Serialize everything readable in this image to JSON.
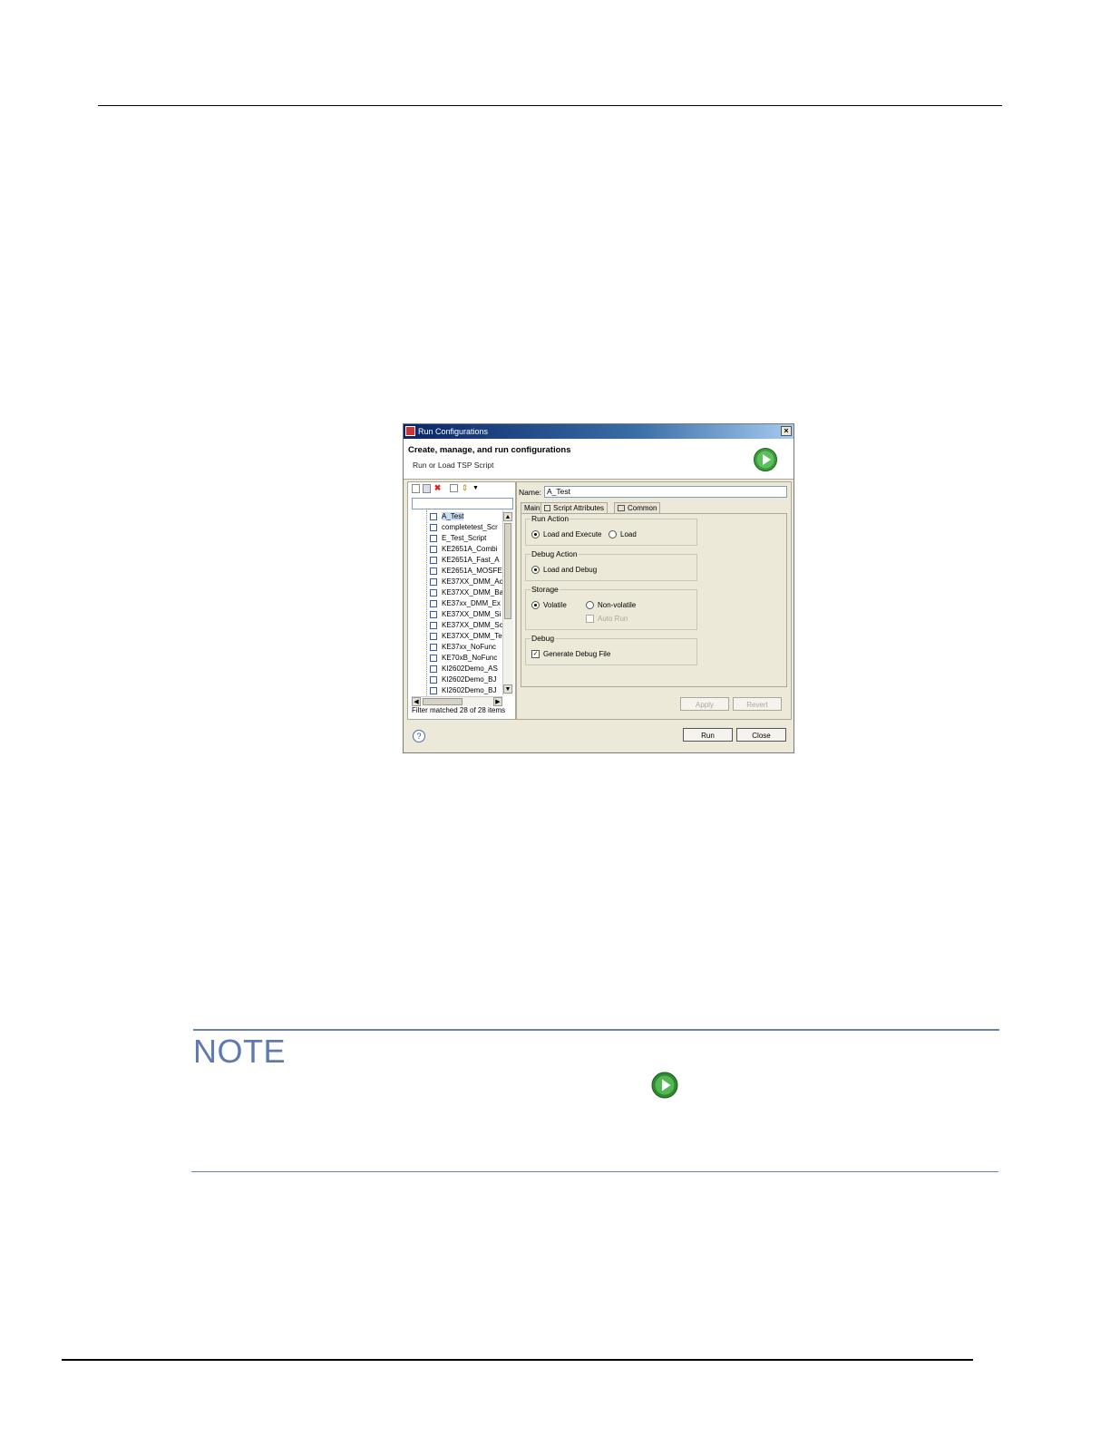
{
  "dialog": {
    "title": "Run Configurations",
    "close_glyph": "×",
    "header_title": "Create, manage, and run configurations",
    "header_subtitle": "Run or Load TSP Script",
    "header_icon": "run-green-icon",
    "toolbar_icons": [
      "new-config-icon",
      "duplicate-icon",
      "delete-icon",
      "collapse-all-icon",
      "filter-icon",
      "dropdown-icon"
    ],
    "tree_items": [
      "A_Test",
      "completetest_Scr",
      "E_Test_Script",
      "KE2651A_Combi",
      "KE2651A_Fast_A",
      "KE2651A_MOSFE",
      "KE37XX_DMM_Ac",
      "KE37XX_DMM_Ba",
      "KE37xx_DMM_Ex",
      "KE37XX_DMM_Si",
      "KE37XX_DMM_Sc",
      "KE37XX_DMM_Te",
      "KE37xx_NoFunc",
      "KE70xB_NoFunc",
      "KI2602Demo_AS",
      "KI2602Demo_BJ",
      "KI2602Demo_BJ"
    ],
    "selected_item": "A_Test",
    "filter_status": "Filter matched 28 of 28 items",
    "name_label": "Name:",
    "name_value": "A_Test",
    "tabs": [
      "Main",
      "Script Attributes",
      "Common"
    ],
    "active_tab": "Script Attributes",
    "groups": {
      "run_action": {
        "title": "Run Action",
        "opt1": "Load and Execute",
        "opt2": "Load",
        "selected": "Load and Execute"
      },
      "debug_action": {
        "title": "Debug Action",
        "opt1": "Load and Debug",
        "selected": "Load and Debug"
      },
      "storage": {
        "title": "Storage",
        "opt1": "Volatile",
        "opt2": "Non-volatile",
        "opt3": "Auto Run",
        "selected": "Volatile"
      },
      "debug": {
        "title": "Debug",
        "opt1": "Generate Debug File",
        "checked": true
      }
    },
    "buttons": {
      "apply": "Apply",
      "revert": "Revert",
      "run": "Run",
      "close": "Close",
      "help": "?"
    }
  },
  "note": {
    "title": "NOTE",
    "icon": "run-green-icon"
  },
  "colors": {
    "note_accent": "#5f79b3",
    "run_icon_green": "#3c9a3c",
    "titlebar": "#0a246a"
  }
}
